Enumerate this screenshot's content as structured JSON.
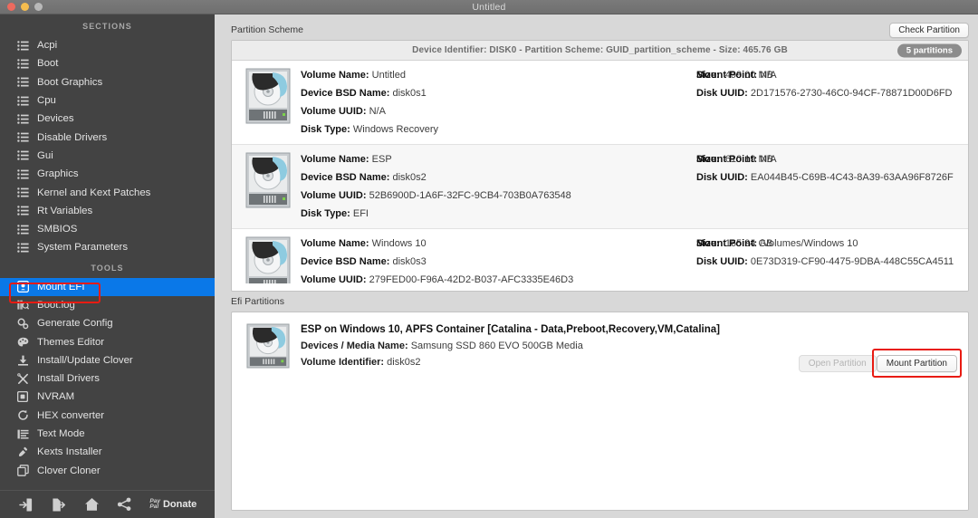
{
  "window": {
    "title": "Untitled"
  },
  "sidebar": {
    "sections_header": "SECTIONS",
    "tools_header": "TOOLS",
    "sections": [
      {
        "label": "Acpi",
        "icon": "list-icon"
      },
      {
        "label": "Boot",
        "icon": "list-icon"
      },
      {
        "label": "Boot Graphics",
        "icon": "list-icon"
      },
      {
        "label": "Cpu",
        "icon": "list-icon"
      },
      {
        "label": "Devices",
        "icon": "list-icon"
      },
      {
        "label": "Disable Drivers",
        "icon": "list-icon"
      },
      {
        "label": "Gui",
        "icon": "list-icon"
      },
      {
        "label": "Graphics",
        "icon": "list-icon"
      },
      {
        "label": "Kernel and Kext Patches",
        "icon": "list-icon"
      },
      {
        "label": "Rt Variables",
        "icon": "list-icon"
      },
      {
        "label": "SMBIOS",
        "icon": "list-icon"
      },
      {
        "label": "System Parameters",
        "icon": "list-icon"
      }
    ],
    "tools": [
      {
        "label": "Mount EFI",
        "icon": "mount-efi-icon",
        "selected": true
      },
      {
        "label": "Boot.log",
        "icon": "boot-log-icon",
        "selected": false
      },
      {
        "label": "Generate Config",
        "icon": "gears-icon",
        "selected": false
      },
      {
        "label": "Themes Editor",
        "icon": "palette-icon",
        "selected": false
      },
      {
        "label": "Install/Update Clover",
        "icon": "download-icon",
        "selected": false
      },
      {
        "label": "Install Drivers",
        "icon": "tools-icon",
        "selected": false
      },
      {
        "label": "NVRAM",
        "icon": "chip-icon",
        "selected": false
      },
      {
        "label": "HEX converter",
        "icon": "refresh-icon",
        "selected": false
      },
      {
        "label": "Text Mode",
        "icon": "text-lines-icon",
        "selected": false
      },
      {
        "label": "Kexts Installer",
        "icon": "plug-icon",
        "selected": false
      },
      {
        "label": "Clover Cloner",
        "icon": "copy-icon",
        "selected": false
      }
    ],
    "toolbar": [
      {
        "name": "import-icon",
        "label": ""
      },
      {
        "name": "export-icon",
        "label": ""
      },
      {
        "name": "home-icon",
        "label": ""
      },
      {
        "name": "share-icon",
        "label": ""
      },
      {
        "name": "paypal-donate",
        "label": "Donate",
        "sub_top": "Pay",
        "sub_bottom": "Pal"
      }
    ]
  },
  "main": {
    "partition_scheme": {
      "section_label": "Partition Scheme",
      "check_partition_button": "Check Partition",
      "summary": "Device Identifier: DISK0 - Partition Scheme: GUID_partition_scheme - Size: 465.76 GB",
      "partitions_badge": "5 partitions",
      "labels": {
        "volume_name": "Volume Name:",
        "device_bsd_name": "Device BSD Name:",
        "volume_uuid": "Volume UUID:",
        "disk_type": "Disk Type:",
        "mount_point": "Mount Point:",
        "disk_uuid": "Disk UUID:",
        "size": "Size:"
      },
      "rows": [
        {
          "volume_name": "Untitled",
          "device_bsd_name": "disk0s1",
          "volume_uuid": "N/A",
          "disk_type": "Windows Recovery",
          "mount_point": "N/A",
          "disk_uuid": "2D171576-2730-46C0-94CF-78871D00D6FD",
          "size": "499.00 MB"
        },
        {
          "volume_name": "ESP",
          "device_bsd_name": "disk0s2",
          "volume_uuid": "52B6900D-1A6F-32FC-9CB4-703B0A763548",
          "disk_type": "EFI",
          "mount_point": "N/A",
          "disk_uuid": "EA044B45-C69B-4C43-8A39-63AA96F8726F",
          "size": "610.19 MB"
        },
        {
          "volume_name": "Windows 10",
          "device_bsd_name": "disk0s3",
          "volume_uuid": "279FED00-F96A-42D2-B037-AFC3335E46D3",
          "disk_type": "",
          "mount_point": "/Volumes/Windows 10",
          "disk_uuid": "0E73D319-CF90-4475-9DBA-448C55CA4511",
          "size": "165.94 GB"
        }
      ]
    },
    "efi_partitions": {
      "section_label": "Efi Partitions",
      "title": "ESP on Windows 10, APFS Container [Catalina - Data,Preboot,Recovery,VM,Catalina]",
      "devices_label": "Devices / Media Name:",
      "devices_value": "Samsung SSD 860 EVO 500GB Media",
      "volume_id_label": "Volume Identifier:",
      "volume_id_value": "disk0s2",
      "open_partition_button": "Open Partition",
      "mount_partition_button": "Mount Partition"
    }
  },
  "colors": {
    "accent_selection": "#0a78e8",
    "annotation": "#e81b12",
    "sidebar_bg": "#434343",
    "panel_bg": "#d8d8d8"
  }
}
